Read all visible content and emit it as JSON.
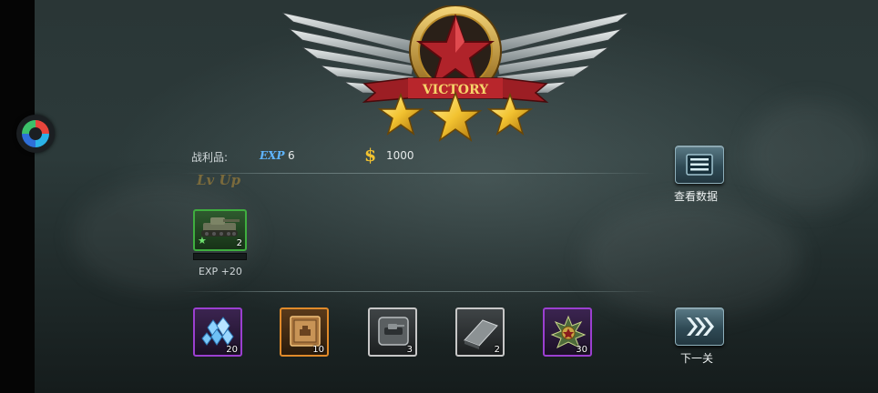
{
  "emblem": {
    "banner_text": "VICTORY",
    "stars_earned": 3,
    "stars_total": 3
  },
  "loot": {
    "label": "战利品:",
    "exp_tag": "EXP",
    "exp_value": "6",
    "gold_icon": "$",
    "gold_value": "1000"
  },
  "level_up_text": "Lv Up",
  "tank": {
    "icon": "tank-icon",
    "level": "2",
    "exp_gain": "EXP +20"
  },
  "buttons": {
    "stats_label": "查看数据",
    "next_label": "下一关"
  },
  "rewards": [
    {
      "icon": "diamond-gems-icon",
      "count": "20",
      "rarity": "purple"
    },
    {
      "icon": "blueprint-crate-icon",
      "count": "10",
      "rarity": "orange"
    },
    {
      "icon": "tank-part-icon",
      "count": "3",
      "rarity": "white"
    },
    {
      "icon": "steel-plate-icon",
      "count": "2",
      "rarity": "white"
    },
    {
      "icon": "medal-badge-icon",
      "count": "30",
      "rarity": "purple"
    }
  ],
  "colors": {
    "accent_blue": "#5fb5ff",
    "gold": "#f2c230",
    "rarity_purple": "#9b3fd0",
    "rarity_orange": "#e08a2a",
    "tank_green": "#3fae3f"
  }
}
